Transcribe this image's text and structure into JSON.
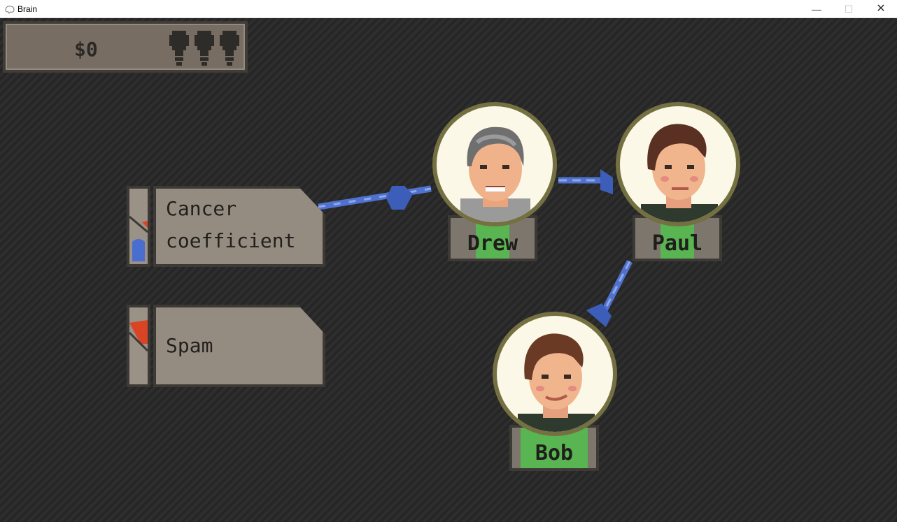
{
  "window": {
    "title": "Brain",
    "minimize_glyph": "—",
    "maximize_glyph": "☐",
    "close_glyph": "✕"
  },
  "hud": {
    "money": "$0",
    "bulbs": [
      "lightbulb-icon",
      "lightbulb-icon",
      "lightbulb-icon"
    ]
  },
  "nodes": [
    {
      "line1": "Cancer",
      "line2": "coefficient",
      "tank_fill": "blue",
      "tank_marker": "red"
    },
    {
      "line1": "Spam",
      "tank_fill": "red"
    }
  ],
  "people": [
    {
      "name": "Drew"
    },
    {
      "name": "Paul"
    },
    {
      "name": "Bob"
    }
  ],
  "colors": {
    "background": "#2b2b2b",
    "panel": "#958c81",
    "panel_border": "#3d3a36",
    "link": "#4f72cf",
    "name_band": "#58b552",
    "portrait_ring": "#757042",
    "portrait_bg": "#fbf8e7",
    "tank_blue": "#4a6ed0",
    "tank_red": "#d84424"
  }
}
